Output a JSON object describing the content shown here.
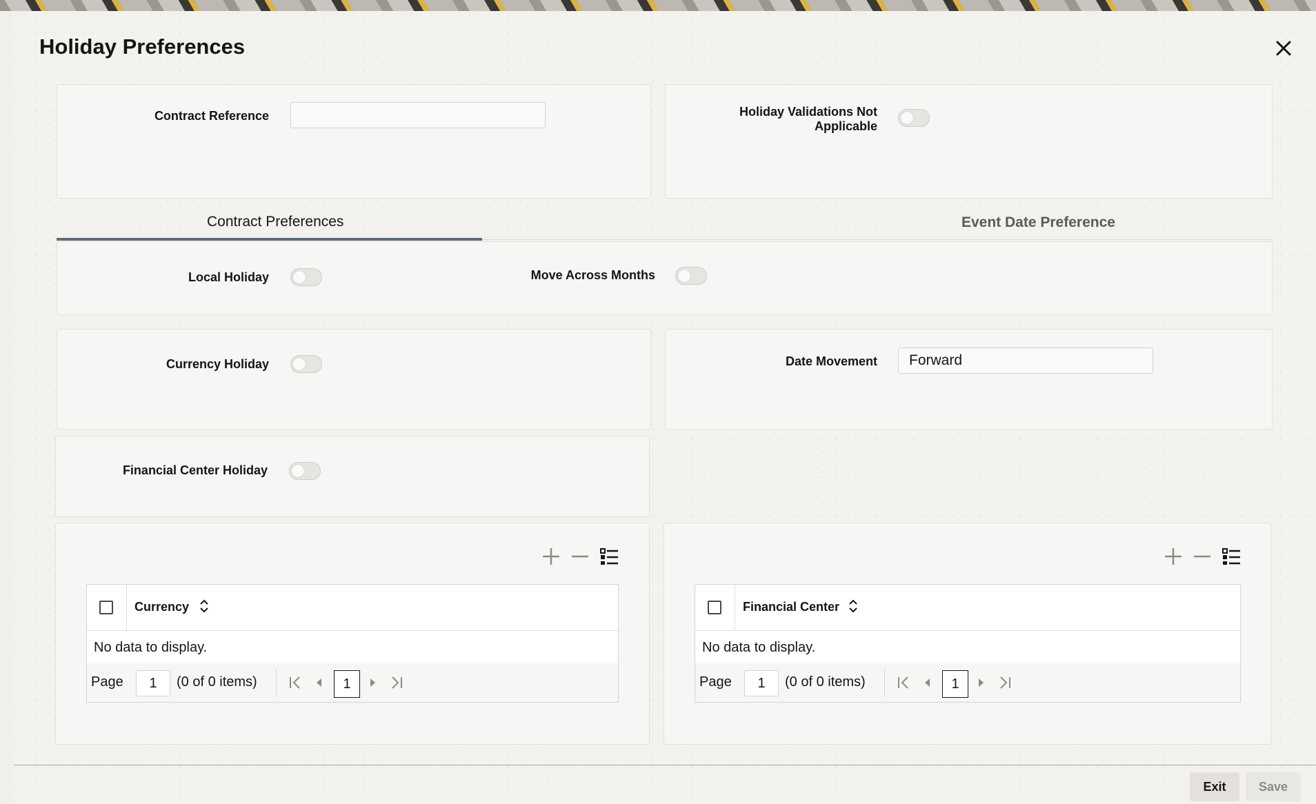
{
  "dialog": {
    "title": "Holiday Preferences",
    "close_icon": "close-icon"
  },
  "header": {
    "contract_reference_label": "Contract Reference",
    "contract_reference_value": "",
    "holiday_validations_label_line1": "Holiday Validations Not",
    "holiday_validations_label_line2": "Applicable",
    "holiday_validations_on": false
  },
  "tabs": [
    {
      "label": "Contract Preferences",
      "active": true
    },
    {
      "label": "Event Date Preference",
      "active": false
    }
  ],
  "contract_preferences": {
    "local_holiday_label": "Local Holiday",
    "local_holiday_on": false,
    "move_across_months_label": "Move Across Months",
    "move_across_months_on": false,
    "currency_holiday_label": "Currency Holiday",
    "currency_holiday_on": false,
    "date_movement_label": "Date Movement",
    "date_movement_value": "Forward",
    "financial_center_holiday_label": "Financial Center Holiday",
    "financial_center_holiday_on": false
  },
  "currency_table": {
    "column": "Currency",
    "empty_text": "No data to display.",
    "page_label": "Page",
    "page_value": "1",
    "items_text": "(0 of 0 items)",
    "current_page": "1"
  },
  "financial_center_table": {
    "column": "Financial Center",
    "empty_text": "No data to display.",
    "page_label": "Page",
    "page_value": "1",
    "items_text": "(0 of 0 items)",
    "current_page": "1"
  },
  "footer": {
    "exit_label": "Exit",
    "save_label": "Save"
  },
  "colors": {
    "active_tab_bar": "#5f6b7a",
    "save_disabled_text": "#8d8a85"
  }
}
